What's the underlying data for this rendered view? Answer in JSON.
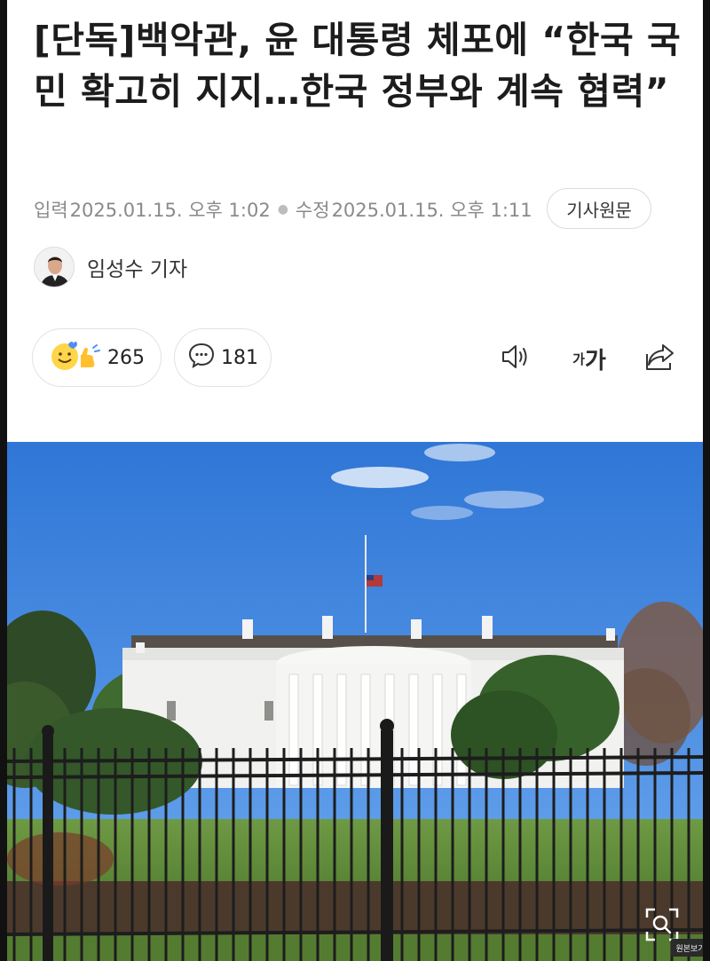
{
  "article": {
    "headline": "[단독]백악관, 윤 대통령 체포에 “한국 국민 확고히 지지…한국 정부와 계속 협력”",
    "published_label": "입력",
    "published": "2025.01.15. 오후 1:02",
    "modified_label": "수정",
    "modified": "2025.01.15. 오후 1:11",
    "source_button": "기사원문",
    "author": "임성수 기자"
  },
  "reactions": {
    "like_count": "265",
    "comment_count": "181"
  },
  "toolbar": {
    "font_small": "가",
    "font_big": "가"
  },
  "photo": {
    "original_view_label": "원본보기"
  },
  "icons": {
    "audio": "speaker-icon",
    "font": "font-size-icon",
    "share": "share-icon",
    "comment": "comment-bubble-icon",
    "like": "smiley-thumbs-up-icon",
    "zoom": "zoom-icon"
  }
}
